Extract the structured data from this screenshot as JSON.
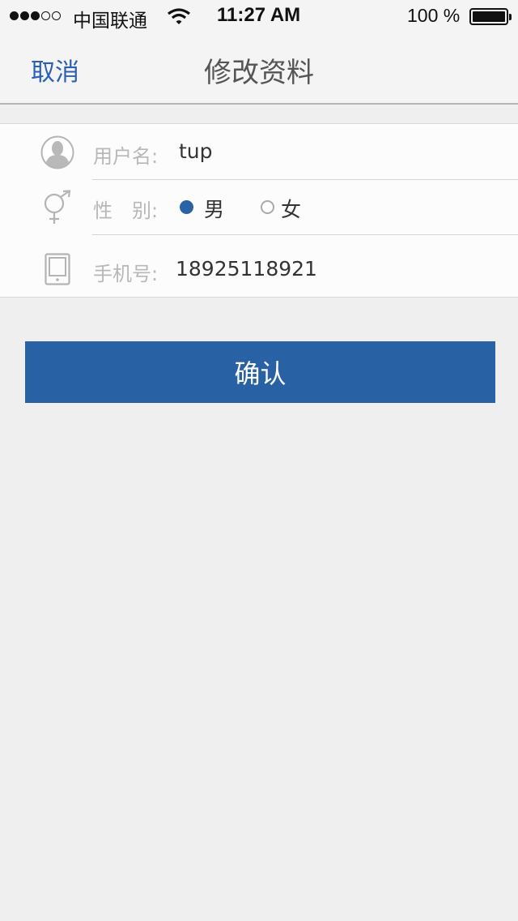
{
  "status_bar": {
    "carrier": "中国联通",
    "time": "11:27 AM",
    "battery": "100 %",
    "signal_bars_filled": 3,
    "signal_bars_total": 5
  },
  "nav": {
    "cancel_label": "取消",
    "title": "修改资料"
  },
  "form": {
    "username": {
      "label": "用户名:",
      "value": "tup",
      "icon": "user-avatar-icon"
    },
    "gender": {
      "label": "性　别:",
      "icon": "gender-icon",
      "options": [
        {
          "label": "男",
          "selected": true
        },
        {
          "label": "女",
          "selected": false
        }
      ]
    },
    "phone": {
      "label": "手机号:",
      "value": "18925118921",
      "icon": "phone-icon"
    }
  },
  "confirm_label": "确认",
  "colors": {
    "accent": "#2962a4",
    "link": "#2b5fb6",
    "background": "#efefef"
  }
}
